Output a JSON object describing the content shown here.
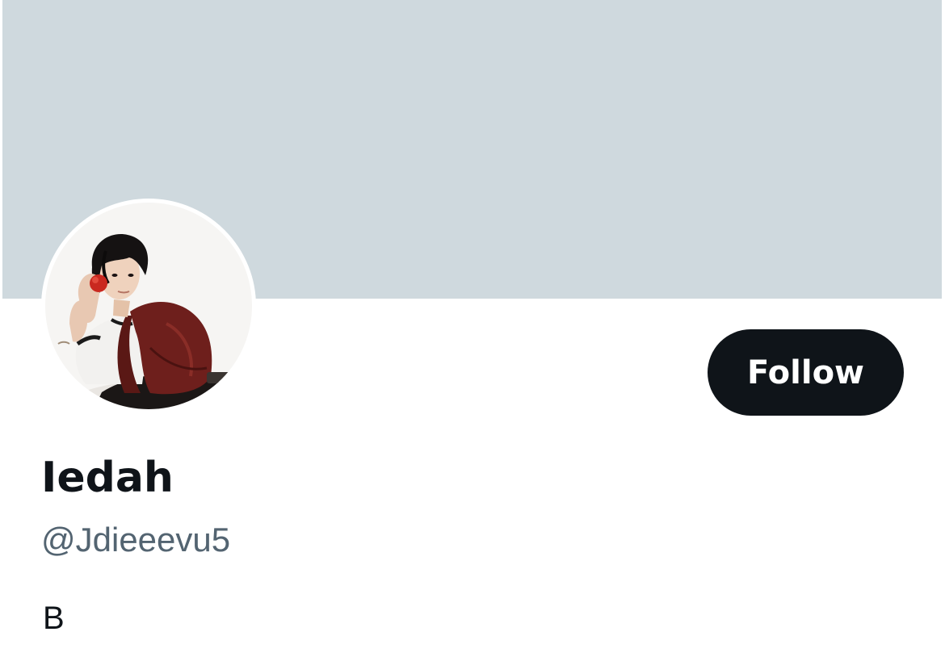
{
  "profile": {
    "display_name": "Iedah",
    "handle": "@Jdieeevu5",
    "bio": "B",
    "follow_label": "Follow",
    "avatar_icon": "profile-photo-person-red-leather-jacket"
  },
  "colors": {
    "banner": "#cfd9de",
    "follow_button_bg": "#0f1419",
    "follow_button_text": "#ffffff",
    "name_text": "#0f1419",
    "handle_text": "#536471"
  }
}
